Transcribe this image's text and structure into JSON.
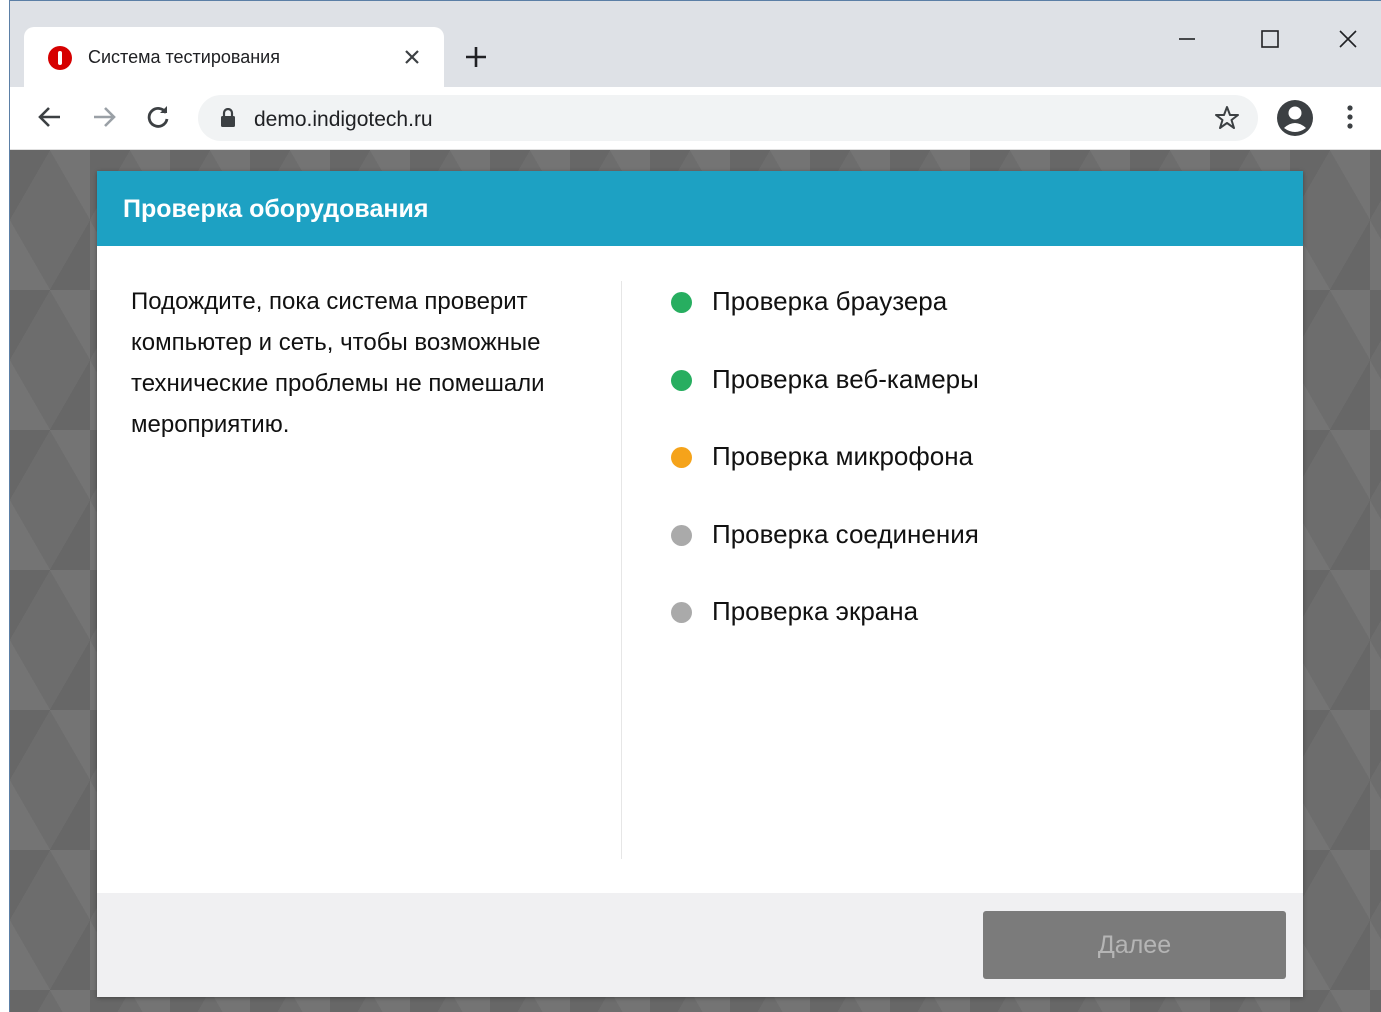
{
  "browser": {
    "tab": {
      "title": "Система тестирования",
      "favicon": "warning-icon",
      "favicon_color": "#d60000"
    },
    "address": {
      "url": "demo.indigotech.ru"
    },
    "icons": {
      "back": "back-arrow-icon",
      "forward": "forward-arrow-icon",
      "reload": "reload-icon",
      "lock": "lock-icon",
      "bookmark": "star-icon",
      "profile": "profile-icon",
      "menu": "kebab-menu-icon",
      "new_tab": "plus-icon",
      "minimize": "minimize-icon",
      "maximize": "maximize-icon",
      "close": "close-icon"
    }
  },
  "dialog": {
    "title": "Проверка оборудования",
    "header_color": "#1da1c3",
    "intro": "Подождите, пока система проверит компьютер и сеть, чтобы возможные технические проблемы не помешали мероприятию.",
    "checks": [
      {
        "label": "Проверка браузера",
        "status": "passed",
        "color": "#27ae60"
      },
      {
        "label": "Проверка веб-камеры",
        "status": "passed",
        "color": "#27ae60"
      },
      {
        "label": "Проверка микрофона",
        "status": "in-progress",
        "color": "#f5a31a"
      },
      {
        "label": "Проверка соединения",
        "status": "pending",
        "color": "#aaaaaa"
      },
      {
        "label": "Проверка экрана",
        "status": "pending",
        "color": "#aaaaaa"
      }
    ],
    "next_button": {
      "label": "Далее",
      "enabled": false
    }
  }
}
